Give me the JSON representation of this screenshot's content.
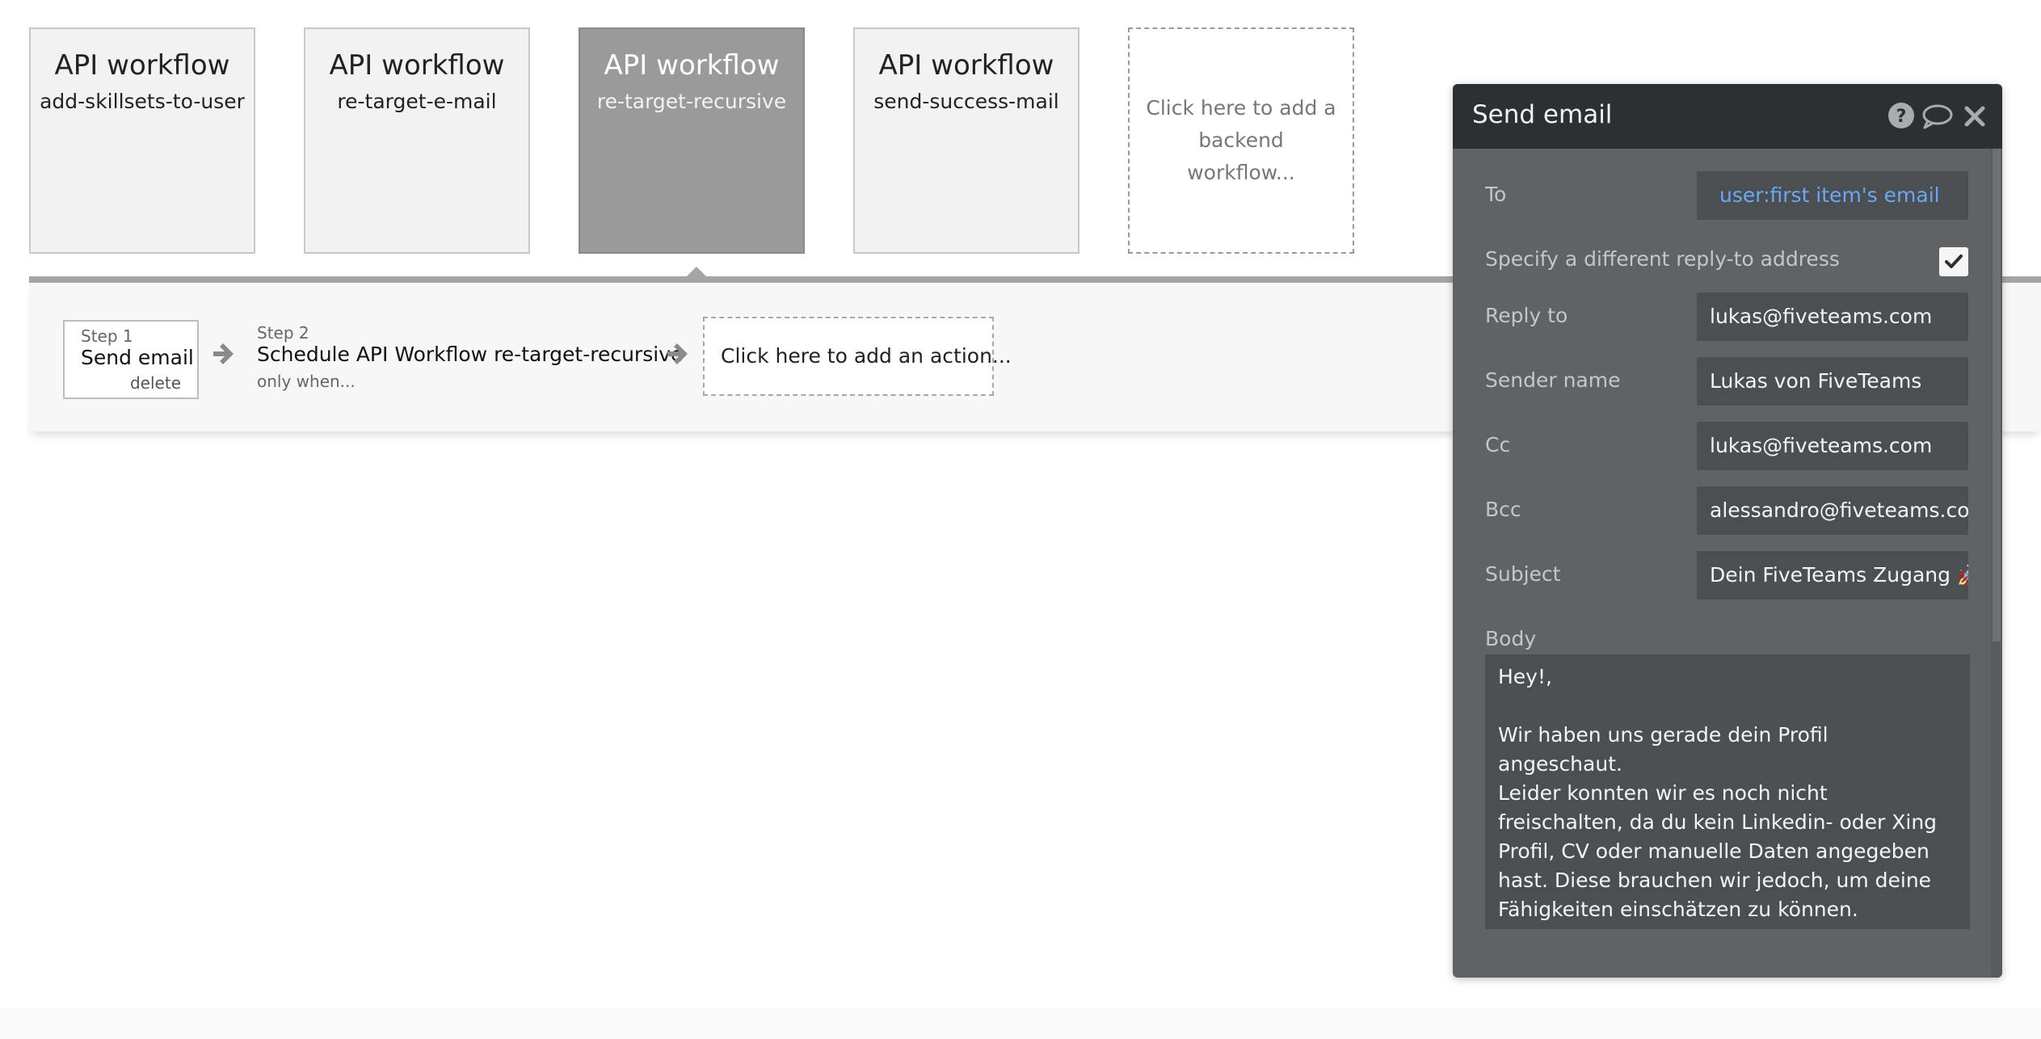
{
  "workflows": [
    {
      "title": "API workflow",
      "name": "add-skillsets-to-user"
    },
    {
      "title": "API workflow",
      "name": "re-target-e-mail"
    },
    {
      "title": "API workflow",
      "name": "re-target-recursive"
    },
    {
      "title": "API workflow",
      "name": "send-success-mail"
    }
  ],
  "add_workflow_label": "Click here to add a backend workflow...",
  "steps": {
    "step1": {
      "label": "Step 1",
      "title": "Send email",
      "delete": "delete"
    },
    "step2": {
      "label": "Step 2",
      "title": "Schedule API Workflow re-target-recursive",
      "condition": "only when..."
    },
    "add_action": "Click here to add an action..."
  },
  "editor": {
    "title": "Send email",
    "fields": {
      "to": {
        "label": "To",
        "value": "user:first item's email"
      },
      "different_reply": {
        "label": "Specify a different reply-to address",
        "checked": true
      },
      "reply_to": {
        "label": "Reply to",
        "value": "lukas@fiveteams.com"
      },
      "sender_name": {
        "label": "Sender name",
        "value": "Lukas von FiveTeams"
      },
      "cc": {
        "label": "Cc",
        "value": "lukas@fiveteams.com"
      },
      "bcc": {
        "label": "Bcc",
        "value": "alessandro@fiveteams.com"
      },
      "subject": {
        "label": "Subject",
        "value": "Dein FiveTeams Zugang 🚀"
      }
    },
    "body_label": "Body",
    "body_value": "Hey!,\n\nWir haben uns gerade dein Profil angeschaut.\nLeider konnten wir es noch nicht freischalten, da du kein Linkedin- oder Xing Profil, CV oder manuelle Daten angegeben hast. Diese brauchen wir jedoch, um deine Fähigkeiten einschätzen zu können.\n\nDies kannst du natürlich jederzeit nachholen, damit du kein Angebot mehr über deinem Wunschgehalt"
  },
  "colors": {
    "selected_card": "#9a9a9a",
    "editor_header": "#2c3033",
    "editor_bg": "#5f6366",
    "dynamic_value": "#6aa7f5"
  }
}
